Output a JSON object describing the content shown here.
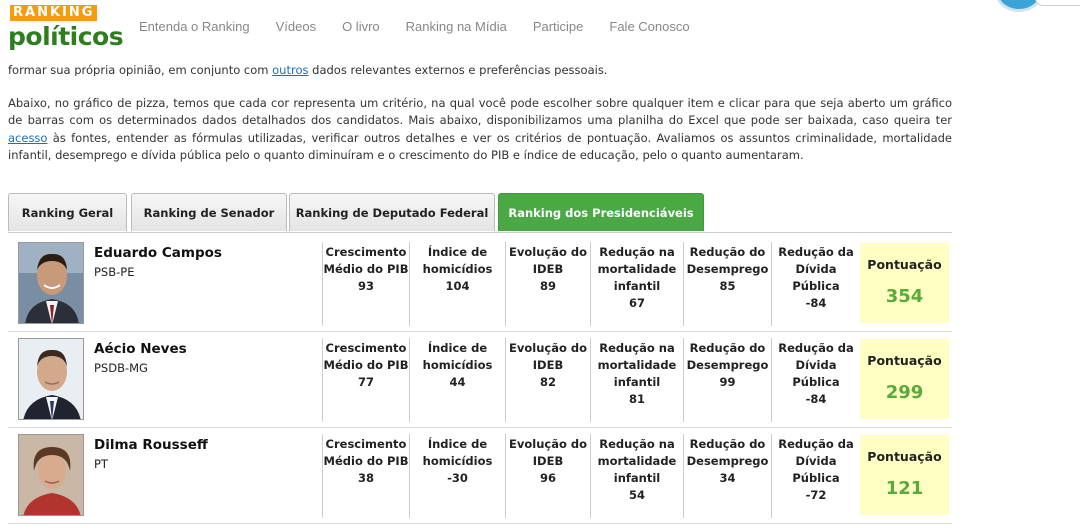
{
  "logo": {
    "top": "RANKING",
    "bottom": "políticos"
  },
  "nav": [
    "Entenda o Ranking",
    "Vídeos",
    "O livro",
    "Ranking na Mídia",
    "Participe",
    "Fale Conosco"
  ],
  "intro": {
    "p1_pre": "formar sua própria opinião, em conjunto com ",
    "p1_link": "outros",
    "p1_post": " dados relevantes externos e preferências pessoais.",
    "p2_pre": "Abaixo, no gráfico de pizza, temos que cada cor representa um critério, na qual você pode escolher sobre qualquer item e clicar para que seja aberto um gráfico de barras com os determinados dados detalhados dos candidatos. Mais abaixo, disponibilizamos uma planilha do Excel que pode ser baixada, caso queira ter ",
    "p2_link": "acesso",
    "p2_post": " às fontes, entender as fórmulas utilizadas, verificar outros detalhes e ver os critérios de pontuação. Avaliamos os assuntos criminalidade, mortalidade infantil, desemprego e dívida pública pelo o quanto diminuíram e o crescimento do PIB e índice de educação, pelo o quanto aumentaram."
  },
  "tabs": [
    "Ranking Geral",
    "Ranking de Senador",
    "Ranking de Deputado Federal",
    "Ranking dos Presidenciáveis"
  ],
  "score_label": "Pontuação",
  "metric_labels": [
    "Crescimento Médio do PIB",
    "Índice de homicídios",
    "Evolução do IDEB",
    "Redução na mortalidade infantil",
    "Redução do Desemprego",
    "Redução da Dívida Pública"
  ],
  "candidates": [
    {
      "name": "Eduardo Campos",
      "party": "PSB-PE",
      "values": [
        "93",
        "104",
        "89",
        "67",
        "85",
        "-84"
      ],
      "score": "354"
    },
    {
      "name": "Aécio Neves",
      "party": "PSDB-MG",
      "values": [
        "77",
        "44",
        "82",
        "81",
        "99",
        "-84"
      ],
      "score": "299"
    },
    {
      "name": "Dilma Rousseff",
      "party": "PT",
      "values": [
        "38",
        "-30",
        "96",
        "54",
        "34",
        "-72"
      ],
      "score": "121"
    }
  ],
  "colors": {
    "accent_green": "#4aa845",
    "score_bg": "#ffffc4",
    "score_text": "#5aaa3a",
    "logo_orange": "#f39c12",
    "logo_green": "#2e7d1e",
    "link": "#1a6fb5"
  }
}
